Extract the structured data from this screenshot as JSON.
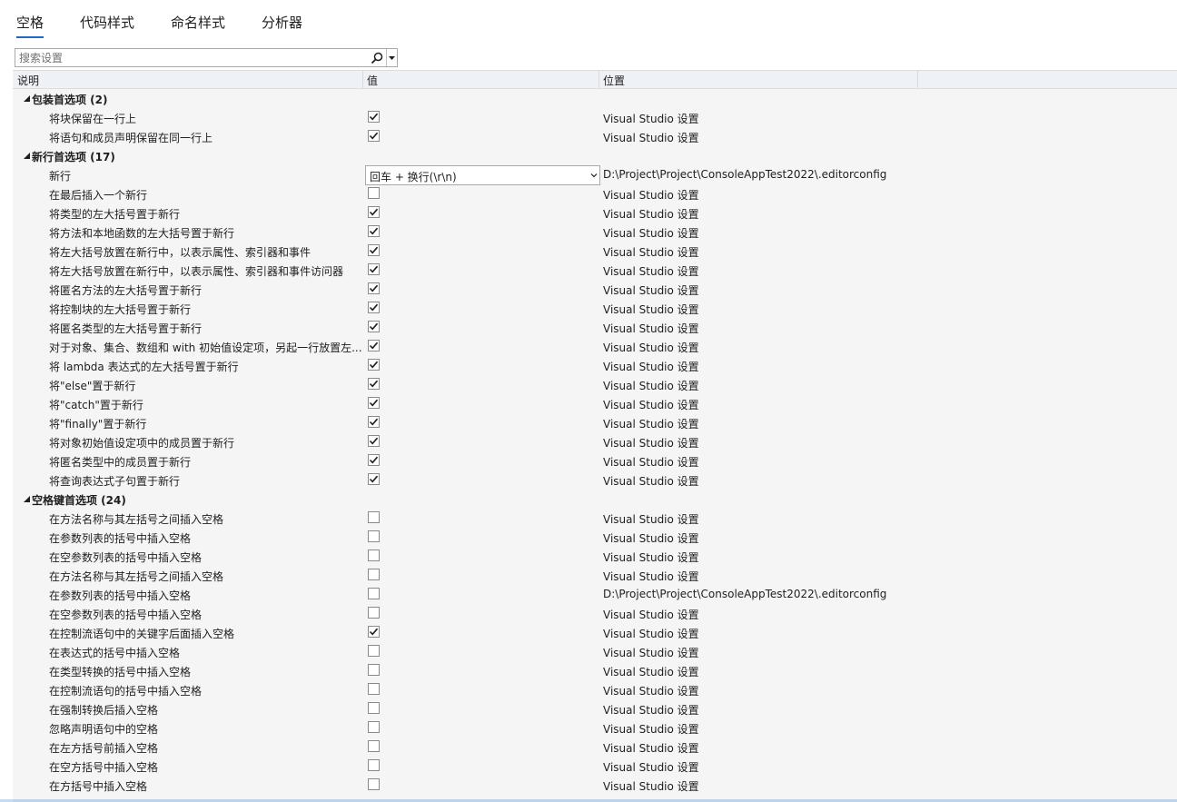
{
  "tabs": [
    {
      "label": "空格",
      "active": true
    },
    {
      "label": "代码样式",
      "active": false
    },
    {
      "label": "命名样式",
      "active": false
    },
    {
      "label": "分析器",
      "active": false
    }
  ],
  "search": {
    "placeholder": "搜索设置",
    "value": "",
    "icon": "search-icon"
  },
  "columns": {
    "description": "说明",
    "value": "值",
    "location": "位置"
  },
  "groups": [
    {
      "label": "包装首选项 (2)",
      "expanded": true,
      "items": [
        {
          "label": "将块保留在一行上",
          "checked": true,
          "location": "Visual Studio 设置"
        },
        {
          "label": "将语句和成员声明保留在同一行上",
          "checked": true,
          "location": "Visual Studio 设置"
        }
      ]
    },
    {
      "label": "新行首选项 (17)",
      "expanded": true,
      "items": [
        {
          "label": "新行",
          "type": "select",
          "value": "回车 + 换行(\\r\\n)",
          "location": "D:\\Project\\Project\\ConsoleAppTest2022\\.editorconfig"
        },
        {
          "label": "在最后插入一个新行",
          "checked": false,
          "location": "Visual Studio 设置"
        },
        {
          "label": "将类型的左大括号置于新行",
          "checked": true,
          "location": "Visual Studio 设置"
        },
        {
          "label": "将方法和本地函数的左大括号置于新行",
          "checked": true,
          "location": "Visual Studio 设置"
        },
        {
          "label": "将左大括号放置在新行中，以表示属性、索引器和事件",
          "checked": true,
          "location": "Visual Studio 设置"
        },
        {
          "label": "将左大括号放置在新行中，以表示属性、索引器和事件访问器",
          "checked": true,
          "location": "Visual Studio 设置"
        },
        {
          "label": "将匿名方法的左大括号置于新行",
          "checked": true,
          "location": "Visual Studio 设置"
        },
        {
          "label": "将控制块的左大括号置于新行",
          "checked": true,
          "location": "Visual Studio 设置"
        },
        {
          "label": "将匿名类型的左大括号置于新行",
          "checked": true,
          "location": "Visual Studio 设置"
        },
        {
          "label": "对于对象、集合、数组和 with 初始值设定项，另起一行放置左...",
          "checked": true,
          "location": "Visual Studio 设置"
        },
        {
          "label": "将 lambda 表达式的左大括号置于新行",
          "checked": true,
          "location": "Visual Studio 设置"
        },
        {
          "label": "将\"else\"置于新行",
          "checked": true,
          "location": "Visual Studio 设置"
        },
        {
          "label": "将\"catch\"置于新行",
          "checked": true,
          "location": "Visual Studio 设置"
        },
        {
          "label": "将\"finally\"置于新行",
          "checked": true,
          "location": "Visual Studio 设置"
        },
        {
          "label": "将对象初始值设定项中的成员置于新行",
          "checked": true,
          "location": "Visual Studio 设置"
        },
        {
          "label": "将匿名类型中的成员置于新行",
          "checked": true,
          "location": "Visual Studio 设置"
        },
        {
          "label": "将查询表达式子句置于新行",
          "checked": true,
          "location": "Visual Studio 设置"
        }
      ]
    },
    {
      "label": "空格键首选项 (24)",
      "expanded": true,
      "items": [
        {
          "label": "在方法名称与其左括号之间插入空格",
          "checked": false,
          "location": "Visual Studio 设置"
        },
        {
          "label": "在参数列表的括号中插入空格",
          "checked": false,
          "location": "Visual Studio 设置"
        },
        {
          "label": "在空参数列表的括号中插入空格",
          "checked": false,
          "location": "Visual Studio 设置"
        },
        {
          "label": "在方法名称与其左括号之间插入空格",
          "checked": false,
          "location": "Visual Studio 设置"
        },
        {
          "label": "在参数列表的括号中插入空格",
          "checked": false,
          "location": "D:\\Project\\Project\\ConsoleAppTest2022\\.editorconfig"
        },
        {
          "label": "在空参数列表的括号中插入空格",
          "checked": false,
          "location": "Visual Studio 设置"
        },
        {
          "label": "在控制流语句中的关键字后面插入空格",
          "checked": true,
          "location": "Visual Studio 设置"
        },
        {
          "label": "在表达式的括号中插入空格",
          "checked": false,
          "location": "Visual Studio 设置"
        },
        {
          "label": "在类型转换的括号中插入空格",
          "checked": false,
          "location": "Visual Studio 设置"
        },
        {
          "label": "在控制流语句的括号中插入空格",
          "checked": false,
          "location": "Visual Studio 设置"
        },
        {
          "label": "在强制转换后插入空格",
          "checked": false,
          "location": "Visual Studio 设置"
        },
        {
          "label": "忽略声明语句中的空格",
          "checked": false,
          "location": "Visual Studio 设置"
        },
        {
          "label": "在左方括号前插入空格",
          "checked": false,
          "location": "Visual Studio 设置"
        },
        {
          "label": "在空方括号中插入空格",
          "checked": false,
          "location": "Visual Studio 设置"
        },
        {
          "label": "在方括号中插入空格",
          "checked": false,
          "location": "Visual Studio 设置"
        }
      ]
    }
  ]
}
